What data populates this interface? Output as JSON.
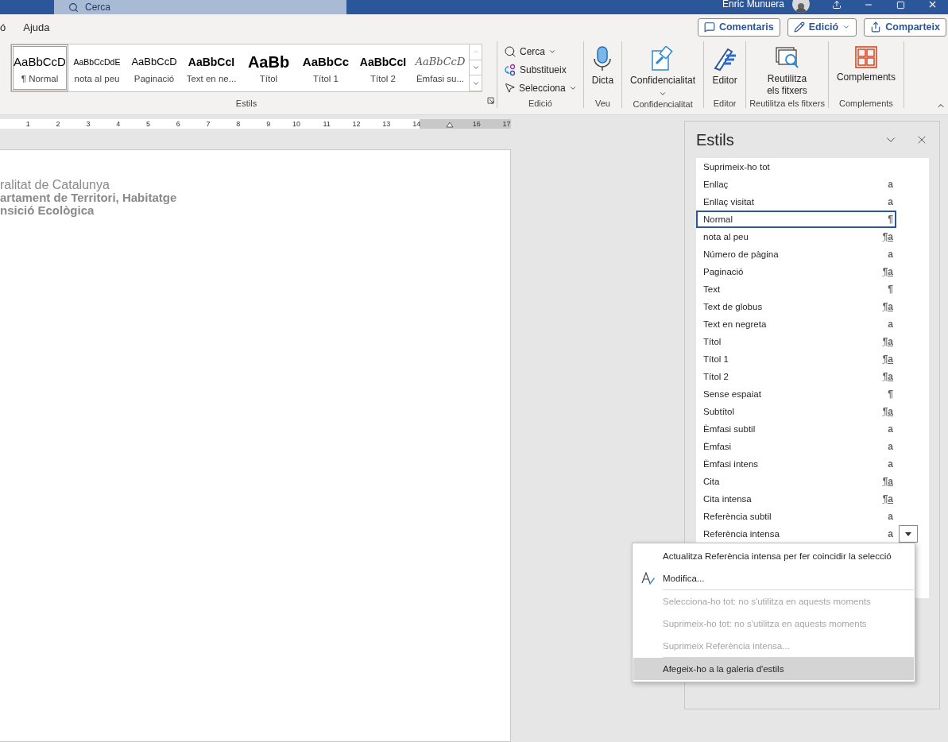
{
  "title_bar": {
    "search_placeholder": "Cerca",
    "user_name": "Enric Munuera"
  },
  "menu_tabs": [
    {
      "label": "ó",
      "selected": false
    },
    {
      "label": "Ajuda",
      "selected": false
    }
  ],
  "header_buttons": [
    {
      "label": "Comentaris",
      "kind": "comments"
    },
    {
      "label": "Edició",
      "kind": "editing"
    },
    {
      "label": "Comparteix",
      "kind": "share"
    }
  ],
  "style_gallery": {
    "group_label": "Estils",
    "items": [
      {
        "preview": "AaBbCcD",
        "label": "¶ Normal",
        "kind": "normal",
        "selected": true
      },
      {
        "preview": "AaBbCcDdE",
        "label": "nota al peu",
        "kind": "small",
        "selected": false
      },
      {
        "preview": "AaBbCcD",
        "label": "Paginació",
        "kind": "pagination",
        "selected": false
      },
      {
        "preview": "AaBbCcI",
        "label": "Text en ne...",
        "kind": "bold",
        "selected": false
      },
      {
        "preview": "AaBb",
        "label": "Títol",
        "kind": "title",
        "selected": false
      },
      {
        "preview": "AaBbCc",
        "label": "Títol 1",
        "kind": "heading1",
        "selected": false
      },
      {
        "preview": "AaBbCcI",
        "label": "Títol 2",
        "kind": "heading2",
        "selected": false
      },
      {
        "preview": "AaBbCcD",
        "label": "Èmfasi su...",
        "kind": "emphasis",
        "selected": false
      }
    ]
  },
  "ribbon_groups": [
    {
      "kind": "small",
      "label": "Edició",
      "commands": [
        {
          "label": "Cerca",
          "kind": "search",
          "caret": true
        },
        {
          "label": "Substitueix",
          "kind": "replace",
          "caret": false
        },
        {
          "label": "Selecciona",
          "kind": "select",
          "caret": true
        }
      ]
    },
    {
      "kind": "large",
      "label": "Veu",
      "commands": [
        {
          "label": "Dicta",
          "kind": "mic",
          "caret": false
        }
      ]
    },
    {
      "kind": "large",
      "label": "Confidencialitat",
      "commands": [
        {
          "label": "Confidencialitat",
          "kind": "sensitivity",
          "caret": true
        }
      ]
    },
    {
      "kind": "large",
      "label": "Editor",
      "commands": [
        {
          "label": "Editor",
          "kind": "editor",
          "caret": false
        }
      ]
    },
    {
      "kind": "large",
      "label": "Reutilitza els fitxers",
      "commands": [
        {
          "label": "Reutilitza els fitxers",
          "kind": "reuse",
          "caret": false
        }
      ]
    },
    {
      "kind": "large",
      "label": "Complements",
      "commands": [
        {
          "label": "Complements",
          "kind": "addins",
          "caret": false
        }
      ]
    }
  ],
  "ruler": {
    "marks": [
      {
        "kind": "number",
        "label": "1"
      },
      {
        "kind": "number",
        "label": "2"
      },
      {
        "kind": "number",
        "label": "3"
      },
      {
        "kind": "number",
        "label": "4"
      },
      {
        "kind": "number",
        "label": "5"
      },
      {
        "kind": "number",
        "label": "6"
      },
      {
        "kind": "number",
        "label": "7"
      },
      {
        "kind": "number",
        "label": "8"
      },
      {
        "kind": "number",
        "label": "9"
      },
      {
        "kind": "number",
        "label": "10"
      },
      {
        "kind": "number",
        "label": "11"
      },
      {
        "kind": "number",
        "label": "12"
      },
      {
        "kind": "number",
        "label": "13"
      },
      {
        "kind": "number",
        "label": "14"
      },
      {
        "kind": "indent_marker"
      },
      {
        "kind": "number",
        "label": "16"
      },
      {
        "kind": "number",
        "label": "17"
      }
    ]
  },
  "document": {
    "lines": [
      {
        "text": "ralitat de Catalunya",
        "bold": false
      },
      {
        "text": "artament de Territori, Habitatge",
        "bold": true
      },
      {
        "text": "nsició Ecològica",
        "bold": true
      }
    ]
  },
  "styles_pane": {
    "title": "Estils",
    "items": [
      {
        "name": "Suprimeix-ho tot",
        "kind": "command",
        "selected": false,
        "menu_open": false
      },
      {
        "name": "Enllaç",
        "kind": "character",
        "symbol": "a",
        "selected": false,
        "menu_open": false
      },
      {
        "name": "Enllaç visitat",
        "kind": "character",
        "symbol": "a",
        "selected": false,
        "menu_open": false
      },
      {
        "name": "Normal",
        "kind": "paragraph",
        "symbol": "¶",
        "selected": true,
        "menu_open": false
      },
      {
        "name": "nota al peu",
        "kind": "linked",
        "symbol": "¶a",
        "selected": false,
        "menu_open": false
      },
      {
        "name": "Número de pàgina",
        "kind": "character",
        "symbol": "a",
        "selected": false,
        "menu_open": false
      },
      {
        "name": "Paginació",
        "kind": "linked",
        "symbol": "¶a",
        "selected": false,
        "menu_open": false
      },
      {
        "name": "Text",
        "kind": "paragraph",
        "symbol": "¶",
        "selected": false,
        "menu_open": false
      },
      {
        "name": "Text de globus",
        "kind": "linked",
        "symbol": "¶a",
        "selected": false,
        "menu_open": false
      },
      {
        "name": "Text en negreta",
        "kind": "character",
        "symbol": "a",
        "selected": false,
        "menu_open": false
      },
      {
        "name": "Títol",
        "kind": "linked",
        "symbol": "¶a",
        "selected": false,
        "menu_open": false
      },
      {
        "name": "Títol 1",
        "kind": "linked",
        "symbol": "¶a",
        "selected": false,
        "menu_open": false
      },
      {
        "name": "Títol 2",
        "kind": "linked",
        "symbol": "¶a",
        "selected": false,
        "menu_open": false
      },
      {
        "name": "Sense espaiat",
        "kind": "paragraph",
        "symbol": "¶",
        "selected": false,
        "menu_open": false
      },
      {
        "name": "Subtítol",
        "kind": "linked",
        "symbol": "¶a",
        "selected": false,
        "menu_open": false
      },
      {
        "name": "Èmfasi subtil",
        "kind": "character",
        "symbol": "a",
        "selected": false,
        "menu_open": false
      },
      {
        "name": "Èmfasi",
        "kind": "character",
        "symbol": "a",
        "selected": false,
        "menu_open": false
      },
      {
        "name": "Èmfasi intens",
        "kind": "character",
        "symbol": "a",
        "selected": false,
        "menu_open": false
      },
      {
        "name": "Cita",
        "kind": "linked",
        "symbol": "¶a",
        "selected": false,
        "menu_open": false
      },
      {
        "name": "Cita intensa",
        "kind": "linked",
        "symbol": "¶a",
        "selected": false,
        "menu_open": false
      },
      {
        "name": "Referència subtil",
        "kind": "character",
        "symbol": "a",
        "selected": false,
        "menu_open": false
      },
      {
        "name": "Referència intensa",
        "kind": "character",
        "symbol": "a",
        "selected": false,
        "menu_open": true
      }
    ]
  },
  "context_menu": {
    "groups": [
      [
        {
          "label": "Actualitza Referència intensa per fer coincidir la selecció",
          "kind": "plain",
          "disabled": false,
          "highlighted": false
        },
        {
          "label": "Modifica...",
          "kind": "with_icon",
          "disabled": false,
          "highlighted": false
        }
      ],
      [
        {
          "label": "Selecciona-ho tot: no s'utilitza en aquests moments",
          "kind": "plain",
          "disabled": true,
          "highlighted": false
        },
        {
          "label": "Suprimeix-ho tot: no s'utilitza en aquests moments",
          "kind": "plain",
          "disabled": true,
          "highlighted": false
        },
        {
          "label": "Suprimeix Referència intensa...",
          "kind": "plain",
          "disabled": true,
          "highlighted": false
        }
      ],
      [
        {
          "label": "Afegeix-ho a la galeria d'estils",
          "kind": "plain",
          "disabled": false,
          "highlighted": true
        }
      ]
    ]
  }
}
